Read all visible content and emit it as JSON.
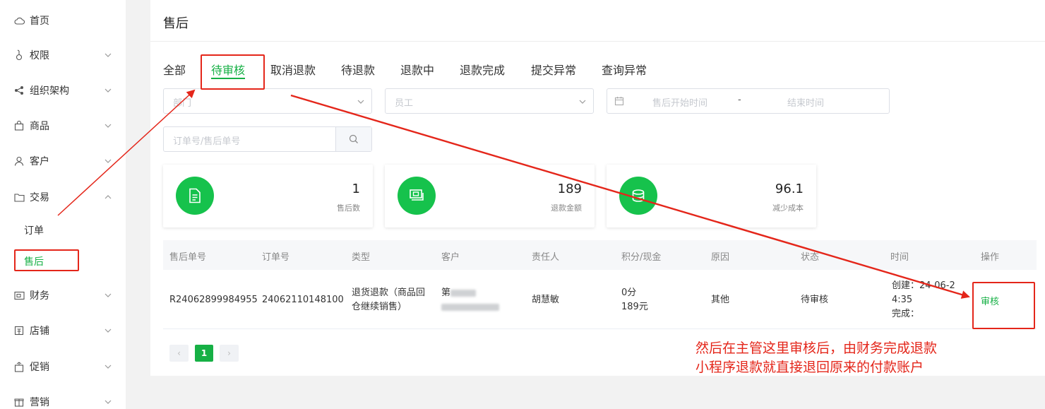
{
  "sidebar": {
    "items": [
      {
        "label": "首页",
        "icon": "cloud-icon",
        "has_chevron": false
      },
      {
        "label": "权限",
        "icon": "key-icon",
        "has_chevron": true
      },
      {
        "label": "组织架构",
        "icon": "share-icon",
        "has_chevron": true
      },
      {
        "label": "商品",
        "icon": "bag-icon",
        "has_chevron": true
      },
      {
        "label": "客户",
        "icon": "user-icon",
        "has_chevron": true
      },
      {
        "label": "交易",
        "icon": "folder-icon",
        "has_chevron": true,
        "expanded": true
      },
      {
        "label": "财务",
        "icon": "wallet-icon",
        "has_chevron": true
      },
      {
        "label": "店铺",
        "icon": "store-icon",
        "has_chevron": true
      },
      {
        "label": "促销",
        "icon": "promo-icon",
        "has_chevron": true
      },
      {
        "label": "营销",
        "icon": "gift-icon",
        "has_chevron": true
      }
    ],
    "sub_items": [
      {
        "label": "订单",
        "active": false
      },
      {
        "label": "售后",
        "active": true
      }
    ]
  },
  "header": {
    "title": "售后"
  },
  "tabs": [
    {
      "label": "全部",
      "active": false
    },
    {
      "label": "待审核",
      "active": true
    },
    {
      "label": "取消退款",
      "active": false
    },
    {
      "label": "待退款",
      "active": false
    },
    {
      "label": "退款中",
      "active": false
    },
    {
      "label": "退款完成",
      "active": false
    },
    {
      "label": "提交异常",
      "active": false
    },
    {
      "label": "查询异常",
      "active": false
    }
  ],
  "filters": {
    "select1_placeholder": "部门",
    "select2_placeholder": "员工",
    "date_start_placeholder": "售后开始时间",
    "date_separator": "-",
    "date_end_placeholder": "结束时间",
    "search_placeholder": "订单号/售后单号"
  },
  "stats": [
    {
      "value": "1",
      "label": "售后数",
      "icon": "document-icon"
    },
    {
      "value": "189",
      "label": "退款金额",
      "icon": "money-icon"
    },
    {
      "value": "96.1",
      "label": "减少成本",
      "icon": "coins-icon"
    }
  ],
  "table": {
    "headers": [
      "售后单号",
      "订单号",
      "类型",
      "客户",
      "责任人",
      "积分/现金",
      "原因",
      "状态",
      "时间",
      "操作"
    ],
    "rows": [
      {
        "aftersale_no": "R24062899984955",
        "order_no": "24062110148100",
        "type_line1": "退货退款（商品回",
        "type_line2": "仓继续销售）",
        "customer_prefix": "第",
        "owner": "胡慧敏",
        "points": "0分",
        "cash": "189元",
        "reason": "其他",
        "status": "待审核",
        "time_line1": "创建：24-06-2",
        "time_line2": "4:35",
        "time_line3": "完成：",
        "action": "审核"
      }
    ]
  },
  "pagination": {
    "prev": "‹",
    "current": "1",
    "next": "›"
  },
  "annotation": {
    "line1": "然后在主管这里审核后，由财务完成退款",
    "line2": "小程序退款就直接退回原来的付款账户",
    "color": "#e4261a"
  },
  "colors": {
    "accent": "#16b045",
    "icon_circle": "#16c24c"
  }
}
